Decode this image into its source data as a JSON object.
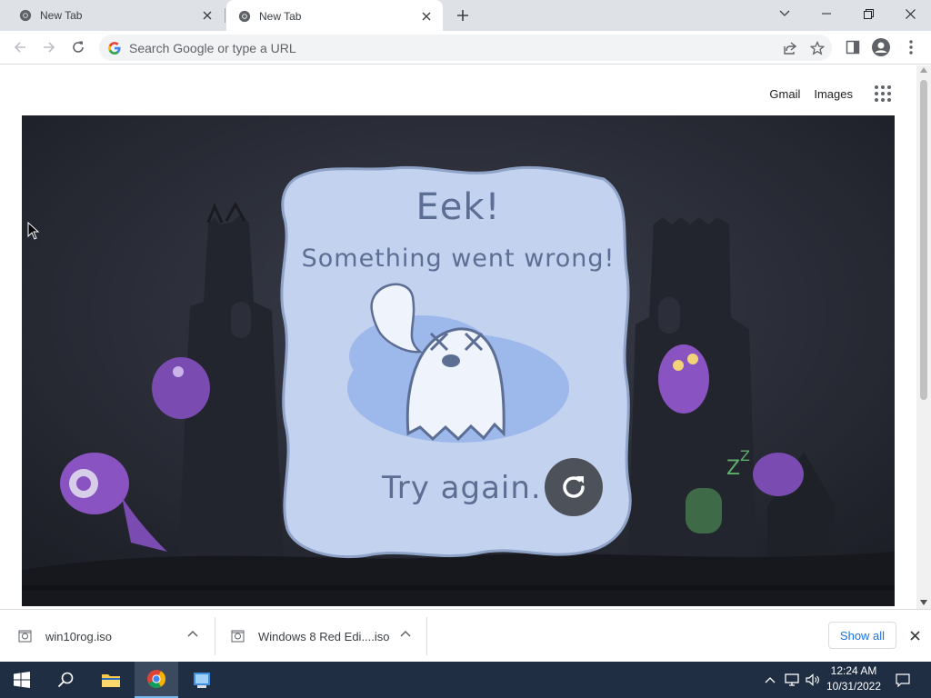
{
  "browser": {
    "tabs": [
      {
        "title": "New Tab",
        "active": false
      },
      {
        "title": "New Tab",
        "active": true
      }
    ],
    "omnibox": {
      "placeholder": "Search Google or type a URL"
    }
  },
  "page": {
    "links": {
      "gmail": "Gmail",
      "images": "Images"
    },
    "game": {
      "heading": "Eek!",
      "message": "Something went wrong!",
      "retry_label": "Try again."
    }
  },
  "downloads": {
    "items": [
      {
        "name": "win10rog.iso"
      },
      {
        "name": "Windows 8 Red Edi....iso"
      }
    ],
    "show_all": "Show all"
  },
  "taskbar": {
    "time": "12:24 AM",
    "date": "10/31/2022"
  },
  "colors": {
    "tab_strip": "#dee1e6",
    "game_background": "#2a2d38",
    "card": "#c3d2ee",
    "card_text": "#5c6e93",
    "taskbar": "#1f2e42",
    "link_blue": "#1a73e8"
  }
}
